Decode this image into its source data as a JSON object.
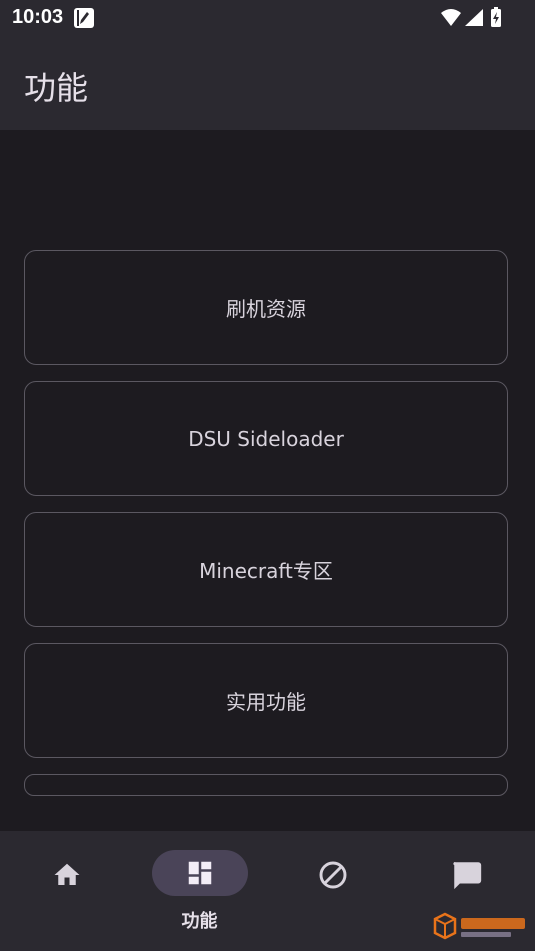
{
  "status_bar": {
    "time": "10:03"
  },
  "app_bar": {
    "title": "功能"
  },
  "cards": [
    {
      "label": "刷机资源"
    },
    {
      "label": "DSU Sideloader"
    },
    {
      "label": "Minecraft专区"
    },
    {
      "label": "实用功能"
    },
    {
      "label": ""
    }
  ],
  "bottom_nav": {
    "items": [
      {
        "icon": "home-icon",
        "label": ""
      },
      {
        "icon": "dashboard-icon",
        "label": "功能",
        "selected": true
      },
      {
        "icon": "block-icon",
        "label": ""
      },
      {
        "icon": "chat-icon",
        "label": ""
      }
    ]
  },
  "colors": {
    "background": "#1d1b20",
    "bar": "#2b2930",
    "card_border": "#5b5861",
    "selected_pill": "#4a4458",
    "text": "#e6e0e9"
  }
}
